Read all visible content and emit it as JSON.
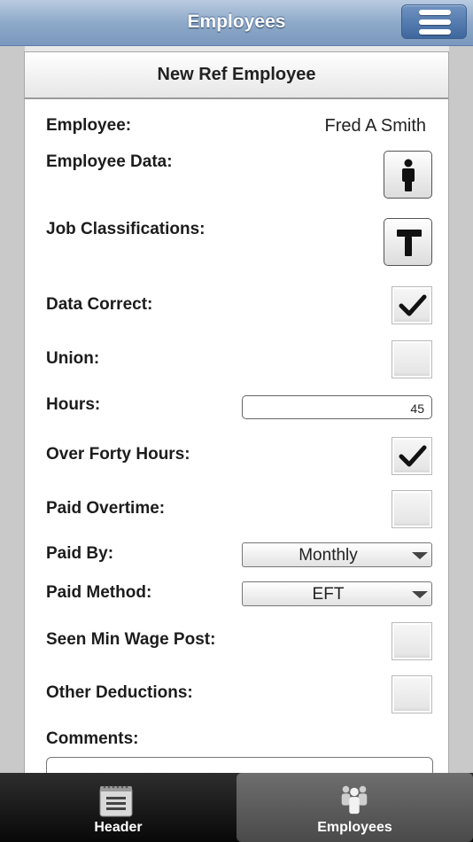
{
  "nav": {
    "title": "Employees"
  },
  "card": {
    "title": "New Ref Employee"
  },
  "form": {
    "employee": {
      "label": "Employee:",
      "value": "Fred A Smith"
    },
    "employee_data": {
      "label": "Employee Data:"
    },
    "job_classifications": {
      "label": "Job Classifications:"
    },
    "data_correct": {
      "label": "Data Correct:",
      "checked": true
    },
    "union": {
      "label": "Union:",
      "checked": false
    },
    "hours": {
      "label": "Hours:",
      "value": "45"
    },
    "over_forty_hours": {
      "label": "Over Forty Hours:",
      "checked": true
    },
    "paid_overtime": {
      "label": "Paid Overtime:",
      "checked": false
    },
    "paid_by": {
      "label": "Paid By:",
      "value": "Monthly"
    },
    "paid_method": {
      "label": "Paid Method:",
      "value": "EFT"
    },
    "seen_min_wage_post": {
      "label": "Seen Min Wage Post:",
      "checked": false
    },
    "other_deductions": {
      "label": "Other Deductions:",
      "checked": false
    },
    "comments": {
      "label": "Comments:",
      "value": ""
    }
  },
  "tabs": [
    {
      "label": "Header",
      "icon": "notepad-icon",
      "active": false
    },
    {
      "label": "Employees",
      "icon": "people-icon",
      "active": true
    }
  ]
}
